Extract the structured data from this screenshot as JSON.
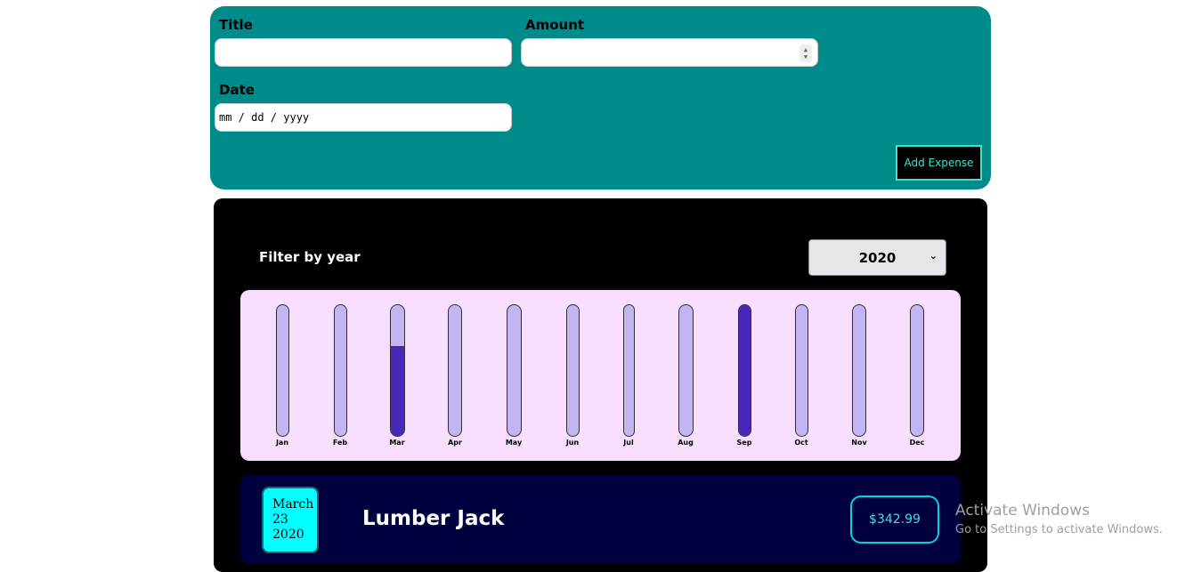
{
  "form": {
    "title_label": "Title",
    "title_value": "",
    "amount_label": "Amount",
    "amount_value": "",
    "date_label": "Date",
    "date_placeholder": "mm / dd / yyyy",
    "add_button_label": "Add Expense"
  },
  "filter": {
    "label": "Filter by year",
    "selected_year": "2020"
  },
  "chart_data": {
    "type": "bar",
    "categories": [
      "Jan",
      "Feb",
      "Mar",
      "Apr",
      "May",
      "Jun",
      "Jul",
      "Aug",
      "Sep",
      "Oct",
      "Nov",
      "Dec"
    ],
    "values": [
      0,
      0,
      0.69,
      0,
      0,
      0,
      0,
      0,
      1.0,
      0,
      0,
      0
    ],
    "colors": {
      "track": "#c3b4f3",
      "fill": "#4826b9",
      "background": "#f8dfff"
    }
  },
  "expenses": [
    {
      "month": "March",
      "day": "23",
      "year": "2020",
      "title": "Lumber Jack",
      "amount": "$342.99"
    }
  ],
  "watermark": {
    "title": "Activate Windows",
    "subtitle": "Go to Settings to activate Windows."
  }
}
